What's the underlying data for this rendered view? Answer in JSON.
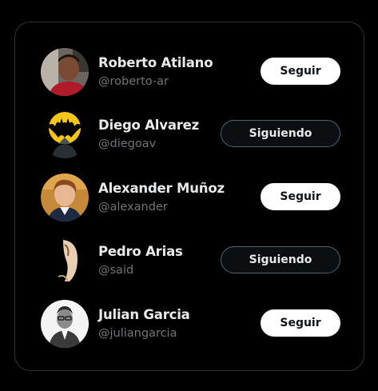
{
  "suggestions": [
    {
      "name": "Roberto Atilano",
      "handle": "@roberto-ar",
      "button": "Seguir",
      "state": "follow",
      "avatar_icon": "roberto-avatar"
    },
    {
      "name": "Diego Alvarez",
      "handle": "@diegoav",
      "button": "Siguiendo",
      "state": "following",
      "avatar_icon": "batman-avatar"
    },
    {
      "name": "Alexander Muñoz",
      "handle": "@alexander",
      "button": "Seguir",
      "state": "follow",
      "avatar_icon": "alexander-avatar"
    },
    {
      "name": "Pedro Arias",
      "handle": "@said",
      "button": "Siguiendo",
      "state": "following",
      "avatar_icon": "pedro-avatar"
    },
    {
      "name": "Julian Garcia",
      "handle": "@juliangarcia",
      "button": "Seguir",
      "state": "follow",
      "avatar_icon": "julian-avatar"
    }
  ],
  "colors": {
    "background": "#000000",
    "name_text": "#e7e9ea",
    "handle_text": "#71767b",
    "follow_button_bg": "#ffffff",
    "following_button_border": "#536471"
  }
}
